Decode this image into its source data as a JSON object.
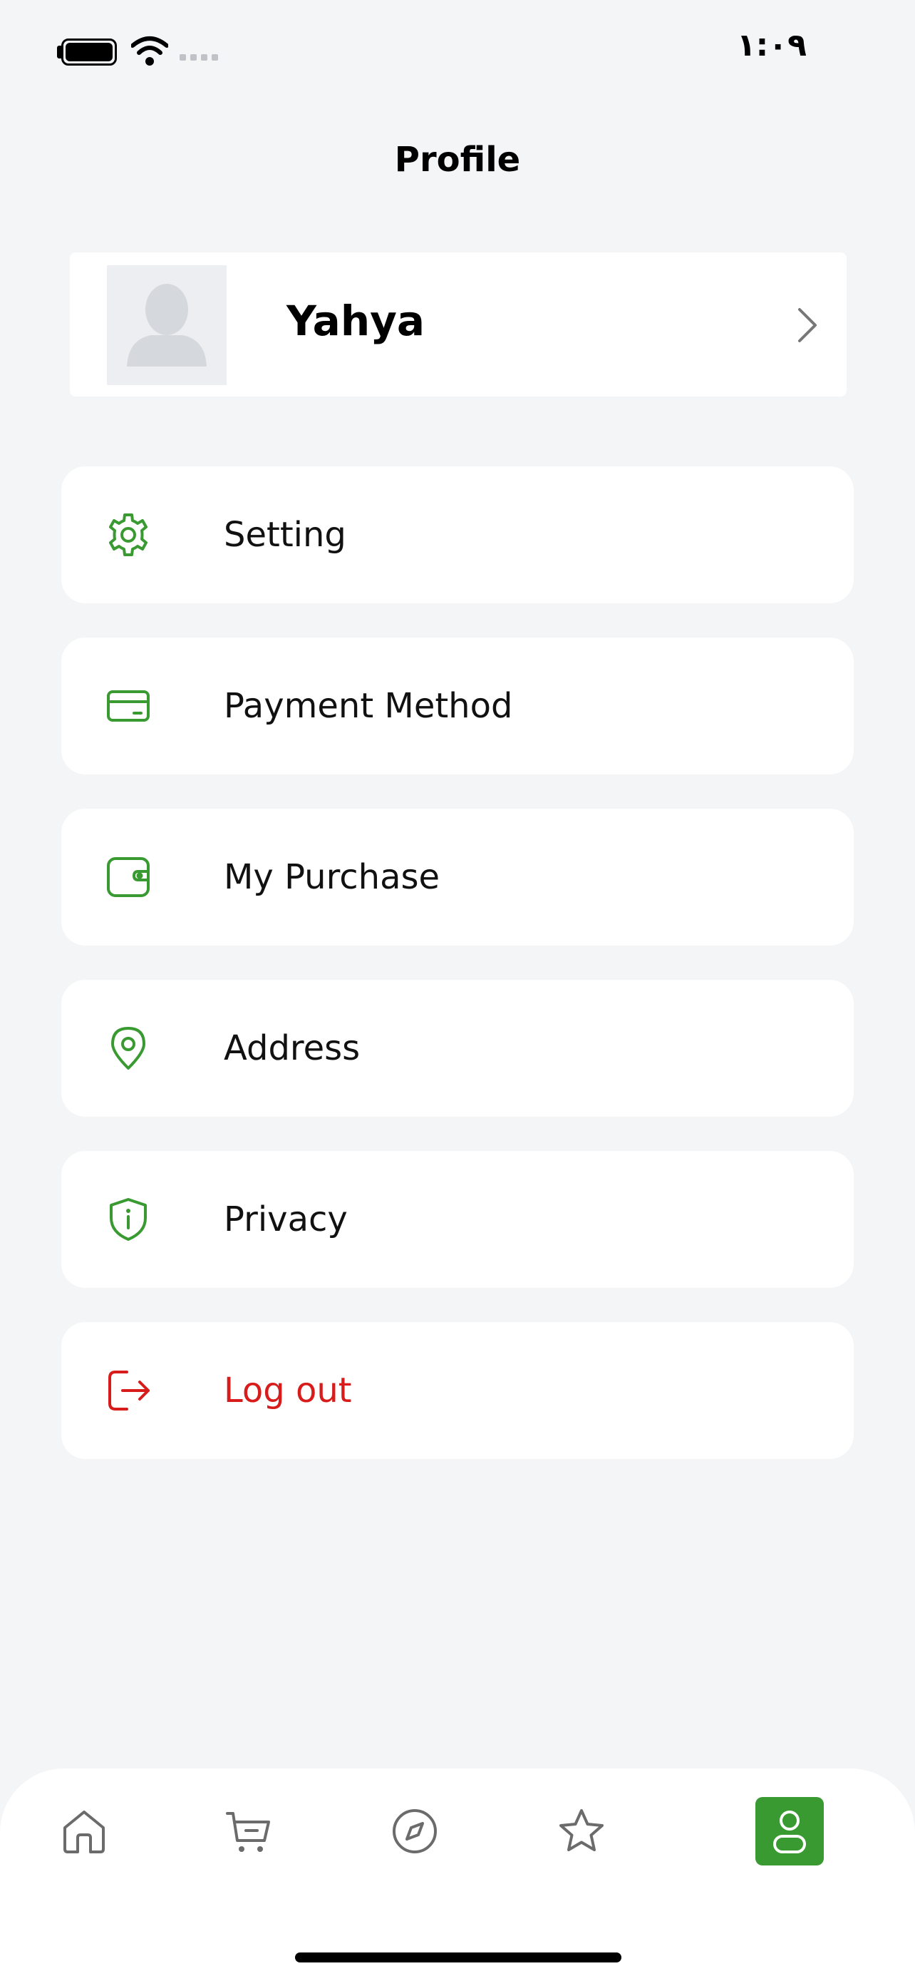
{
  "status_bar": {
    "time": "١:٠٩"
  },
  "header": {
    "title": "Profile"
  },
  "profile": {
    "name": "Yahya"
  },
  "menu": {
    "items": [
      {
        "label": "Setting",
        "icon": "gear-icon"
      },
      {
        "label": "Payment Method",
        "icon": "credit-card-icon"
      },
      {
        "label": "My Purchase",
        "icon": "wallet-icon"
      },
      {
        "label": "Address",
        "icon": "location-pin-icon"
      },
      {
        "label": "Privacy",
        "icon": "shield-info-icon"
      },
      {
        "label": "Log out",
        "icon": "logout-icon"
      }
    ]
  },
  "bottom_nav": {
    "items": [
      {
        "icon": "home-icon"
      },
      {
        "icon": "cart-icon"
      },
      {
        "icon": "compass-icon"
      },
      {
        "icon": "star-icon"
      },
      {
        "icon": "user-icon",
        "active": true
      }
    ]
  },
  "colors": {
    "accent": "#3a9a32",
    "danger": "#d81b1b",
    "background": "#f4f5f7",
    "card": "#ffffff"
  }
}
